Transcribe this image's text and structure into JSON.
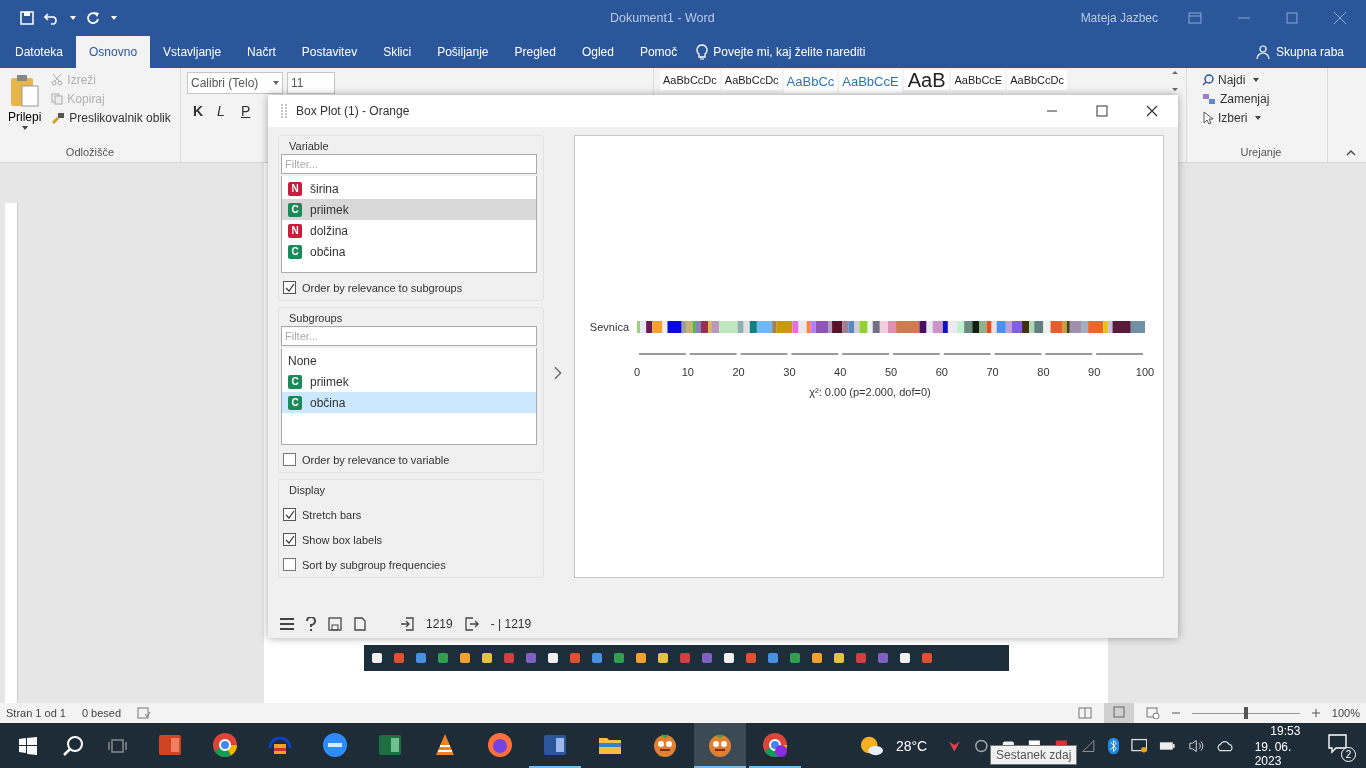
{
  "window": {
    "title": "Dokument1 - Word",
    "user": "Mateja Jazbec"
  },
  "tabs": [
    {
      "label": "Datoteka",
      "selected": false
    },
    {
      "label": "Osnovno",
      "selected": true
    },
    {
      "label": "Vstavljanje",
      "selected": false
    },
    {
      "label": "Načrt",
      "selected": false
    },
    {
      "label": "Postavitev",
      "selected": false
    },
    {
      "label": "Sklici",
      "selected": false
    },
    {
      "label": "Pošiljanje",
      "selected": false
    },
    {
      "label": "Pregled",
      "selected": false
    },
    {
      "label": "Ogled",
      "selected": false
    },
    {
      "label": "Pomoč",
      "selected": false
    }
  ],
  "tell_me": "Povejte mi, kaj želite narediti",
  "share": "Skupna raba",
  "ribbon": {
    "clipboard": {
      "paste": "Prilepi",
      "items": [
        {
          "label": "Izreži",
          "kind": "cut",
          "disabled": true
        },
        {
          "label": "Kopiraj",
          "kind": "copy",
          "disabled": true
        },
        {
          "label": "Preslikovalnik oblik",
          "kind": "format",
          "disabled": false
        }
      ],
      "group": "Odložišče"
    },
    "font": {
      "family": "Calibri (Telo)",
      "size": "11",
      "styles": [
        "K",
        "L",
        "P"
      ]
    },
    "style_previews": [
      "AaBbCcDc",
      "AaBbCcDc",
      "AaBbCc",
      "AaBbCcE",
      "AaB",
      "AaBbCcE",
      "AaBbCcDc"
    ],
    "editing": {
      "items": [
        {
          "label": "Najdi",
          "kind": "find",
          "dropdown": true
        },
        {
          "label": "Zamenjaj",
          "kind": "replace",
          "dropdown": false
        },
        {
          "label": "Izberi",
          "kind": "select",
          "dropdown": true
        }
      ],
      "group": "Urejanje"
    }
  },
  "dialog": {
    "title": "Box Plot (1) - Orange",
    "variable": {
      "title": "Variable",
      "placeholder": "Filter...",
      "items": [
        {
          "type": "N",
          "name": "širina",
          "selected": false
        },
        {
          "type": "C",
          "name": "priimek",
          "selected": true
        },
        {
          "type": "N",
          "name": "dolžina",
          "selected": false
        },
        {
          "type": "C",
          "name": "občina",
          "selected": false
        }
      ],
      "order": {
        "label": "Order by relevance to subgroups",
        "checked": true
      }
    },
    "subgroups": {
      "title": "Subgroups",
      "placeholder": "Filter...",
      "items": [
        {
          "name": "None",
          "selected": false
        },
        {
          "type": "C",
          "name": "priimek",
          "selected": false
        },
        {
          "type": "C",
          "name": "občina",
          "selected": true
        }
      ],
      "order": {
        "label": "Order by relevance to variable",
        "checked": false
      }
    },
    "display": {
      "title": "Display",
      "options": [
        {
          "label": "Stretch bars",
          "checked": true
        },
        {
          "label": "Show box labels",
          "checked": true
        },
        {
          "label": "Sort by subgroup frequencies",
          "checked": false
        }
      ]
    },
    "plot": {
      "chart_data": {
        "type": "bar",
        "orientation": "horizontal",
        "stacked": true,
        "categories": [
          "Sevnica"
        ],
        "xlim": [
          0,
          100
        ],
        "xticks": [
          0,
          10,
          20,
          30,
          40,
          50,
          60,
          70,
          80,
          90,
          100
        ],
        "series": [
          {
            "color": "#9bd07a",
            "values": [
              0.6
            ]
          },
          {
            "color": "#e6e6f2",
            "values": [
              1.2
            ]
          },
          {
            "color": "#6a1b4d",
            "values": [
              1.2
            ]
          },
          {
            "color": "#f5a030",
            "values": [
              2.0
            ]
          },
          {
            "color": "#eeeeee",
            "values": [
              1.0
            ]
          },
          {
            "color": "#0a0ae0",
            "values": [
              2.8
            ]
          },
          {
            "color": "#a09f8a",
            "values": [
              1.0
            ]
          },
          {
            "color": "#c8b070",
            "values": [
              1.2
            ]
          },
          {
            "color": "#40c040",
            "values": [
              0.6
            ]
          },
          {
            "color": "#8c7fc0",
            "values": [
              1.0
            ]
          },
          {
            "color": "#9a3050",
            "values": [
              1.4
            ]
          },
          {
            "color": "#d8c040",
            "values": [
              0.6
            ]
          },
          {
            "color": "#b89ab8",
            "values": [
              1.6
            ]
          },
          {
            "color": "#c0e6c0",
            "values": [
              3.6
            ]
          },
          {
            "color": "#8fb0b0",
            "values": [
              1.2
            ]
          },
          {
            "color": "#e0e0e0",
            "values": [
              1.2
            ]
          },
          {
            "color": "#0f7f7f",
            "values": [
              1.4
            ]
          },
          {
            "color": "#6fb8f0",
            "values": [
              3.0
            ]
          },
          {
            "color": "#a08060",
            "values": [
              0.8
            ]
          },
          {
            "color": "#c89a10",
            "values": [
              3.2
            ]
          },
          {
            "color": "#e070e0",
            "values": [
              1.2
            ]
          },
          {
            "color": "#e8e8e8",
            "values": [
              1.6
            ]
          },
          {
            "color": "#ff8040",
            "values": [
              0.8
            ]
          },
          {
            "color": "#b080ff",
            "values": [
              1.0
            ]
          },
          {
            "color": "#8f55b5",
            "values": [
              2.4
            ]
          },
          {
            "color": "#b0a0c0",
            "values": [
              0.8
            ]
          },
          {
            "color": "#5a0f2a",
            "values": [
              2.0
            ]
          },
          {
            "color": "#a08090",
            "values": [
              1.2
            ]
          },
          {
            "color": "#5b88c0",
            "values": [
              1.2
            ]
          },
          {
            "color": "#d0d0d0",
            "values": [
              1.0
            ]
          },
          {
            "color": "#90d030",
            "values": [
              1.6
            ]
          },
          {
            "color": "#f0f0f0",
            "values": [
              1.0
            ]
          },
          {
            "color": "#707088",
            "values": [
              1.4
            ]
          },
          {
            "color": "#f0d0e0",
            "values": [
              1.6
            ]
          },
          {
            "color": "#e090b0",
            "values": [
              1.6
            ]
          },
          {
            "color": "#d07a50",
            "values": [
              4.6
            ]
          },
          {
            "color": "#4a1060",
            "values": [
              1.4
            ]
          },
          {
            "color": "#e8e8f0",
            "values": [
              1.2
            ]
          },
          {
            "color": "#d090c8",
            "values": [
              2.0
            ]
          },
          {
            "color": "#1010c0",
            "values": [
              1.0
            ]
          },
          {
            "color": "#f0e8f0",
            "values": [
              1.8
            ]
          },
          {
            "color": "#c0f0d0",
            "values": [
              1.4
            ]
          },
          {
            "color": "#6a8a80",
            "values": [
              1.6
            ]
          },
          {
            "color": "#102010",
            "values": [
              1.4
            ]
          },
          {
            "color": "#90b090",
            "values": [
              1.4
            ]
          },
          {
            "color": "#e05020",
            "values": [
              1.0
            ]
          },
          {
            "color": "#f0e0e0",
            "values": [
              1.0
            ]
          },
          {
            "color": "#4a90f0",
            "values": [
              1.8
            ]
          },
          {
            "color": "#c0a0d0",
            "values": [
              1.2
            ]
          },
          {
            "color": "#8060e0",
            "values": [
              2.0
            ]
          },
          {
            "color": "#403010",
            "values": [
              1.4
            ]
          },
          {
            "color": "#b0d8b0",
            "values": [
              1.0
            ]
          },
          {
            "color": "#5f7f80",
            "values": [
              1.8
            ]
          },
          {
            "color": "#f0f0f0",
            "values": [
              1.4
            ]
          },
          {
            "color": "#e06030",
            "values": [
              2.4
            ]
          },
          {
            "color": "#c0a040",
            "values": [
              0.8
            ]
          },
          {
            "color": "#404020",
            "values": [
              0.6
            ]
          },
          {
            "color": "#a090b0",
            "values": [
              2.2
            ]
          },
          {
            "color": "#a0b0c0",
            "values": [
              1.4
            ]
          },
          {
            "color": "#e66a30",
            "values": [
              3.0
            ]
          },
          {
            "color": "#e8c020",
            "values": [
              1.0
            ]
          },
          {
            "color": "#c0c0e0",
            "values": [
              0.8
            ]
          },
          {
            "color": "#5a1a3a",
            "values": [
              3.6
            ]
          },
          {
            "color": "#7090a8",
            "values": [
              2.8
            ]
          }
        ]
      },
      "statistic": "χ²: 0.00 (p=2.000, dof=0)"
    },
    "footer": {
      "input_count": "1219",
      "output_count": "- | 1219"
    }
  },
  "status_bar": {
    "page": "Stran 1 od 1",
    "words": "0 besed",
    "zoom": "100%",
    "zoom_slider": {
      "level": 0.5
    }
  },
  "taskbar": {
    "apps": [
      {
        "kind": "powerpoint",
        "running": false,
        "selected": false
      },
      {
        "kind": "chrome",
        "running": false,
        "selected": false
      },
      {
        "kind": "headphones",
        "running": false,
        "selected": false
      },
      {
        "kind": "zoom",
        "running": false,
        "selected": false
      },
      {
        "kind": "excel",
        "running": false,
        "selected": false
      },
      {
        "kind": "vlc",
        "running": false,
        "selected": false
      },
      {
        "kind": "firefox",
        "running": false,
        "selected": false
      },
      {
        "kind": "word",
        "running": true,
        "selected": false
      },
      {
        "kind": "folder",
        "running": false,
        "selected": false
      },
      {
        "kind": "mascot",
        "running": false,
        "selected": false
      },
      {
        "kind": "mascot",
        "running": true,
        "selected": true
      },
      {
        "kind": "chrome",
        "running": true,
        "selected": false
      }
    ],
    "weather": "28°C",
    "time": "19:53",
    "date": "19. 06. 2023",
    "notifications": "2",
    "tooltip": "Sestanek zdaj"
  }
}
